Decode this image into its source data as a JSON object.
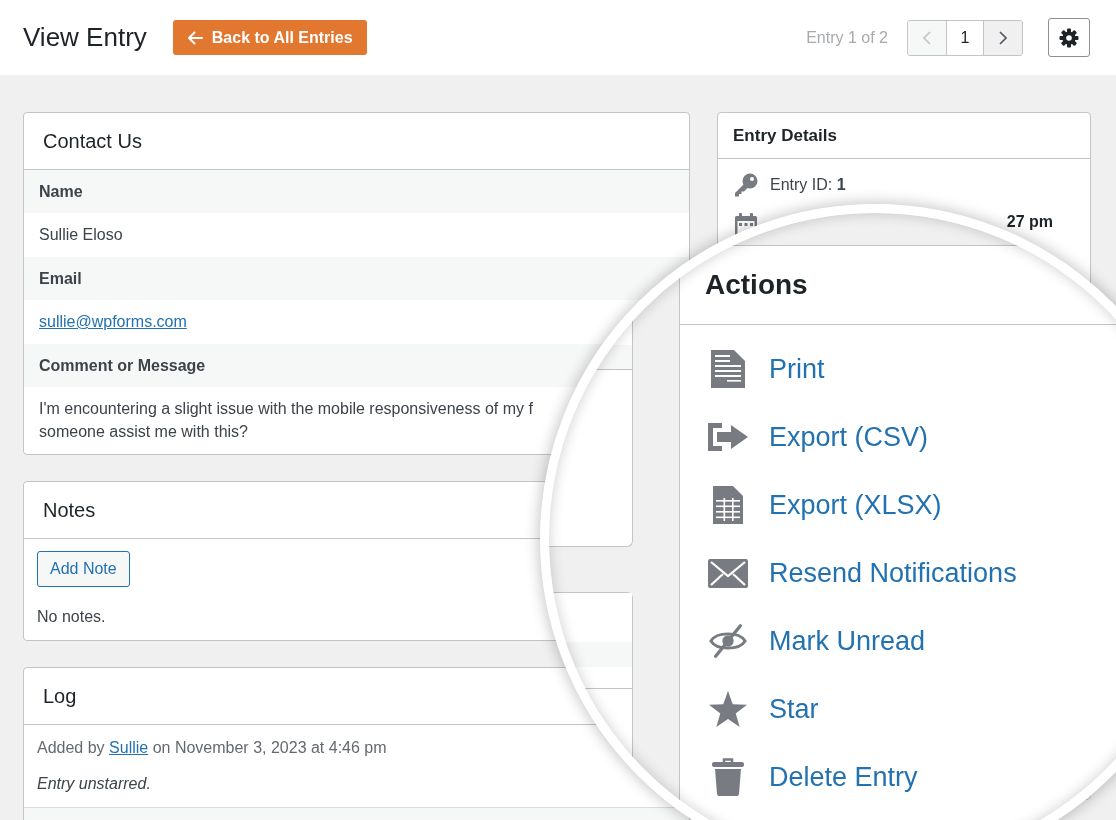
{
  "header": {
    "title": "View Entry",
    "back_button": "Back to All Entries",
    "counter": "Entry 1 of 2",
    "pager": {
      "previous": {
        "disabled": true
      },
      "page": "1",
      "next": {
        "disabled": false
      }
    }
  },
  "contact_card": {
    "title": "Contact Us",
    "fields": [
      {
        "label": "Name",
        "kind": "text",
        "value": "Sullie Eloso"
      },
      {
        "label": "Email",
        "kind": "link",
        "value": "sullie@wpforms.com"
      },
      {
        "label": "Comment or Message",
        "kind": "paragraph",
        "lines": [
          "I'm encountering a slight issue with the mobile responsiveness of my f",
          "someone assist me with this?"
        ]
      }
    ]
  },
  "notes_card": {
    "title": "Notes",
    "button": "Add Note",
    "empty_text": "No notes."
  },
  "log_card": {
    "title": "Log",
    "entries": [
      {
        "prefix": "Added by",
        "author": "Sullie",
        "suffix": "on November 3, 2023 at 4:46 pm",
        "message": "Entry unstarred."
      }
    ]
  },
  "entry_details": {
    "title": "Entry Details",
    "rows": [
      {
        "kind": "id",
        "text": "Entry ID: **1**"
      },
      {
        "kind": "date",
        "text": "27 pm"
      }
    ]
  },
  "actions_panel": {
    "title": "Actions",
    "items": [
      {
        "label": "Print"
      },
      {
        "label": "Export (CSV)"
      },
      {
        "label": "Export (XLSX)"
      },
      {
        "label": "Resend Notifications"
      },
      {
        "label": "Mark Unread"
      },
      {
        "label": "Star"
      },
      {
        "label": "Delete Entry"
      }
    ]
  }
}
